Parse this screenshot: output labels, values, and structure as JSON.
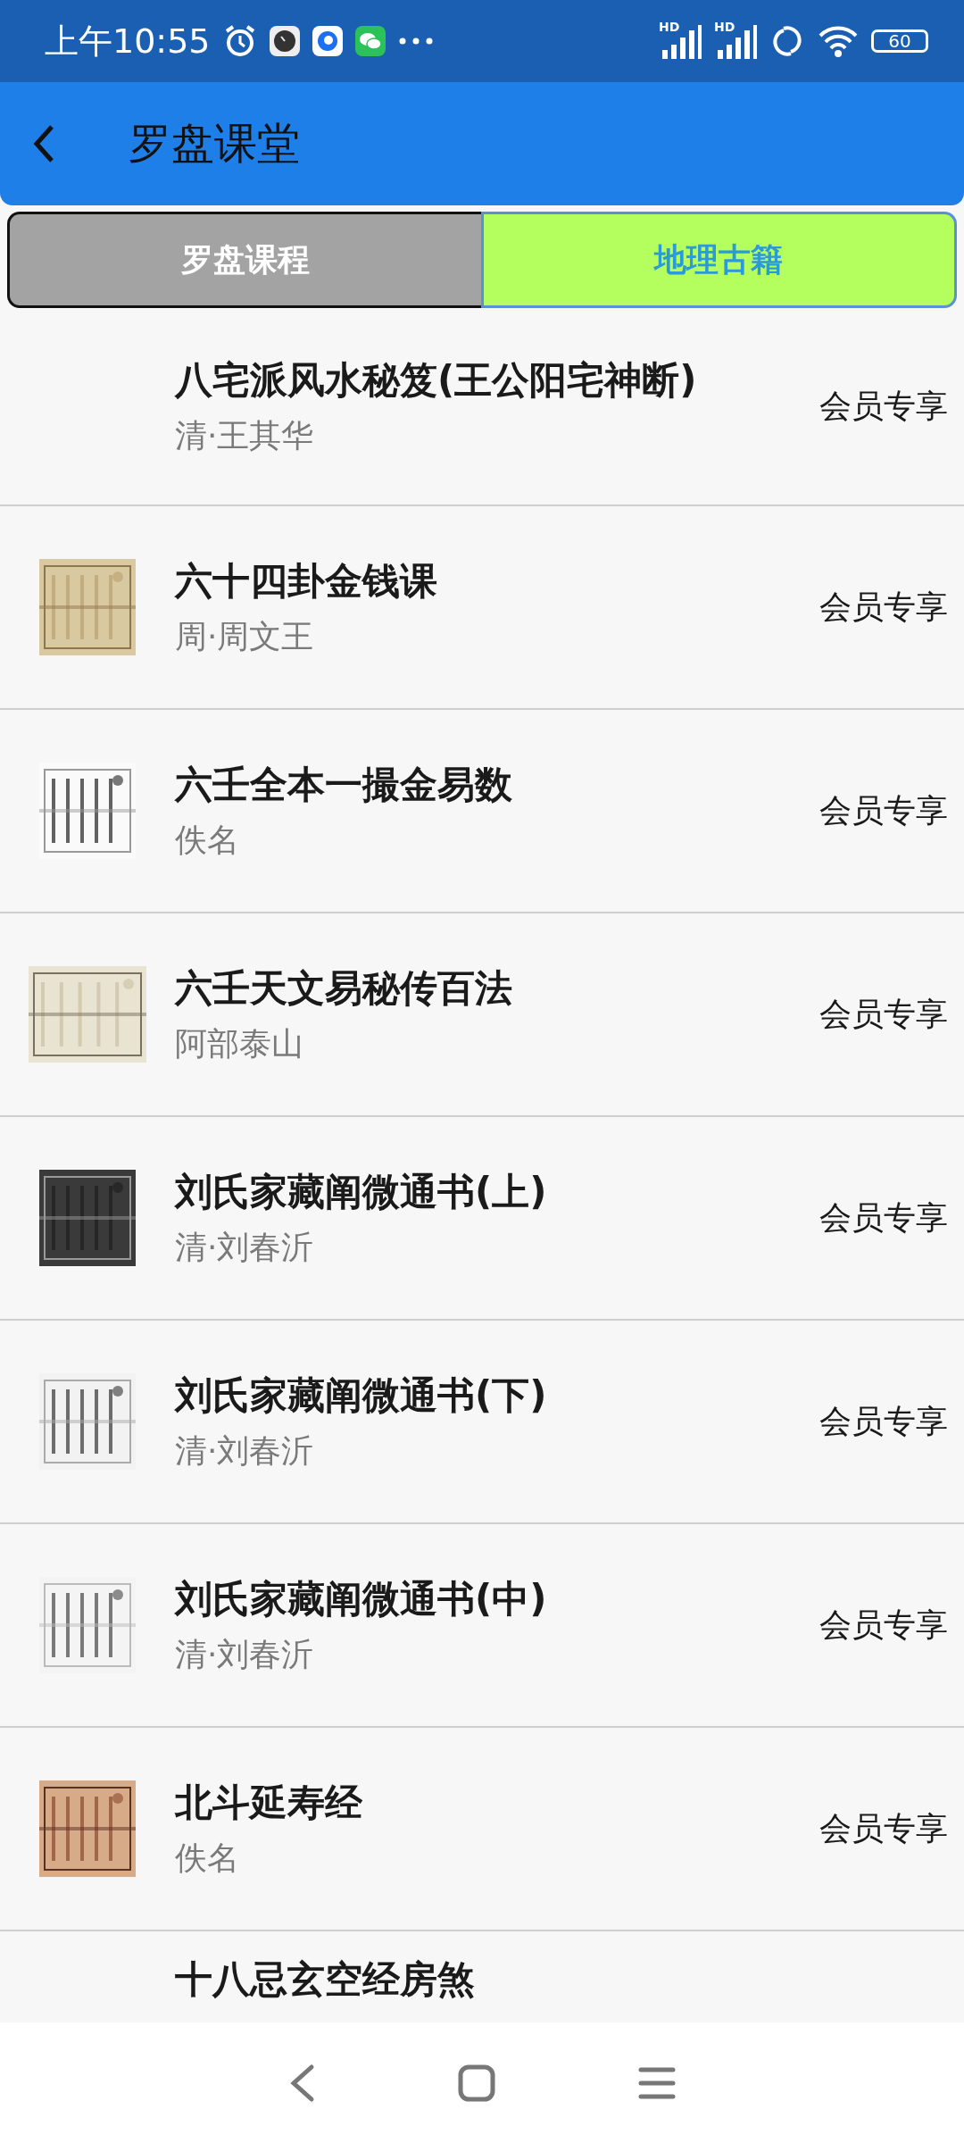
{
  "status_bar": {
    "time": "上午10:55",
    "signals": [
      {
        "label": "HD"
      },
      {
        "label": "HD"
      }
    ],
    "battery": "60"
  },
  "app_bar": {
    "title": "罗盘课堂"
  },
  "tabs": [
    {
      "label": "罗盘课程",
      "selected": false
    },
    {
      "label": "地理古籍",
      "selected": true
    }
  ],
  "books": [
    {
      "title": "八宅派风水秘笈(王公阳宅神断)",
      "author": "清·王其华",
      "badge": "会员专享"
    },
    {
      "title": "六十四卦金钱课",
      "author": "周·周文王",
      "badge": "会员专享"
    },
    {
      "title": "六壬全本一撮金易数",
      "author": "佚名",
      "badge": "会员专享"
    },
    {
      "title": "六壬天文易秘传百法",
      "author": "阿部泰山",
      "badge": "会员专享"
    },
    {
      "title": "刘氏家藏阐微通书(上)",
      "author": "清·刘春沂",
      "badge": "会员专享"
    },
    {
      "title": "刘氏家藏阐微通书(下)",
      "author": "清·刘春沂",
      "badge": "会员专享"
    },
    {
      "title": "刘氏家藏阐微通书(中)",
      "author": "清·刘春沂",
      "badge": "会员专享"
    },
    {
      "title": "北斗延寿经",
      "author": "佚名",
      "badge": "会员专享"
    },
    {
      "title": "十八忌玄空经房煞"
    }
  ]
}
